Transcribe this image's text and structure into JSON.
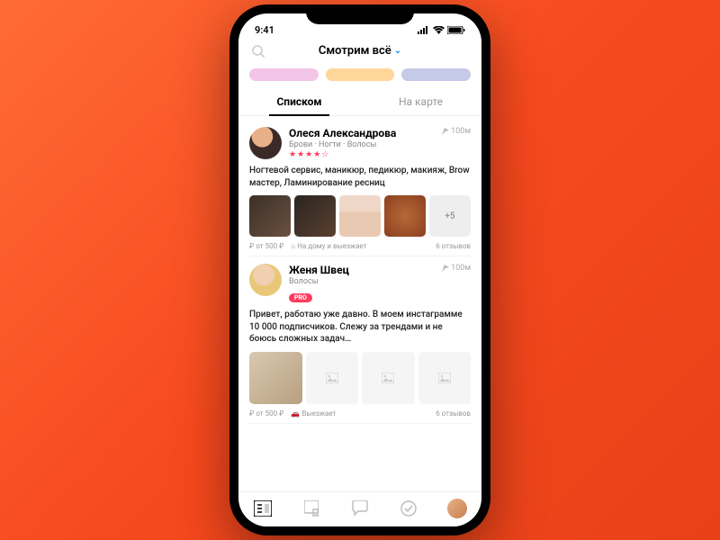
{
  "statusbar": {
    "time": "9:41"
  },
  "header": {
    "title": "Смотрим всё"
  },
  "tabs": {
    "list": "Списком",
    "map": "На карте"
  },
  "cards": [
    {
      "name": "Олеся Александрова",
      "distance": "100м",
      "categories": "Брови · Ногти · Волосы",
      "rating_display": "★★★★☆",
      "description": "Ногтевой сервис, маникюр, педикюр, макияж, Brow мастер, Ламинирование ресниц",
      "more_thumb": "+5",
      "price": "от 500 ₽",
      "mode": "На дому и выезжает",
      "reviews": "6 отзывов"
    },
    {
      "name": "Женя Швец",
      "distance": "100м",
      "categories": "Волосы",
      "pro": "PRO",
      "description": "Привет, работаю уже давно. В моем инстаграмме 10 000 подписчиков. Слежу за трендами и не боюсь сложных задач…",
      "price": "от 500 ₽",
      "mode": "Выезжает",
      "reviews": "6 отзывов"
    }
  ]
}
